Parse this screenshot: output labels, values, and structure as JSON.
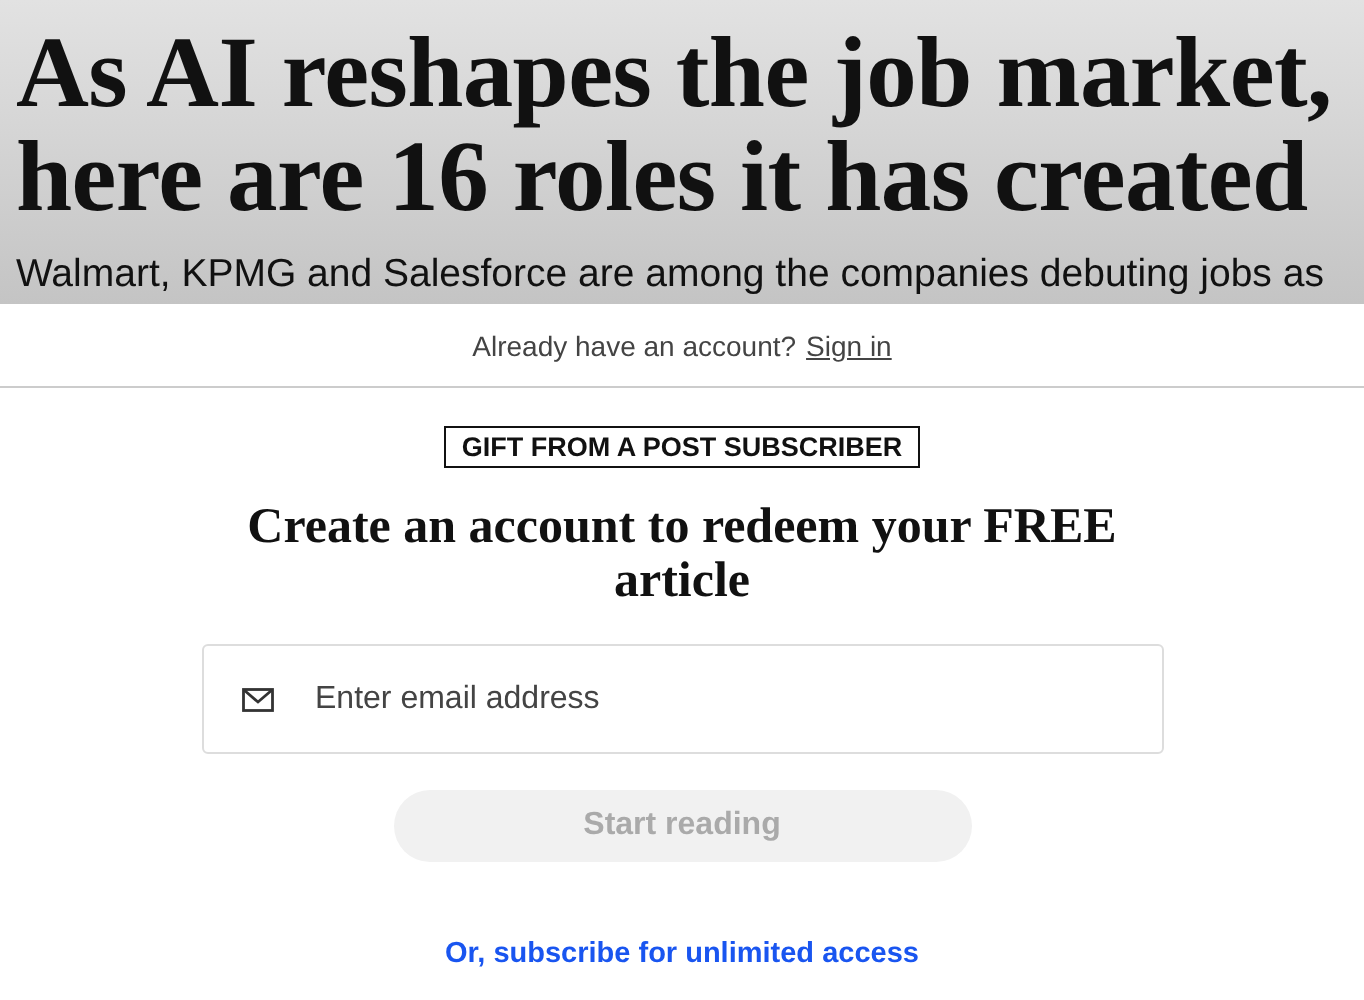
{
  "article": {
    "headline": "As AI reshapes the job market, here are 16 roles it has created",
    "dek": "Walmart, KPMG and Salesforce are among the companies debuting jobs as"
  },
  "signin_prompt": {
    "text": "Already have an account?",
    "link": "Sign in"
  },
  "badge": "GIFT FROM A POST SUBSCRIBER",
  "heading": "Create an account to redeem your FREE article",
  "email_field": {
    "placeholder": "Enter email address"
  },
  "submit_button": {
    "label": "Start reading",
    "disabled": true
  },
  "subscribe_link": "Or, subscribe for unlimited access"
}
